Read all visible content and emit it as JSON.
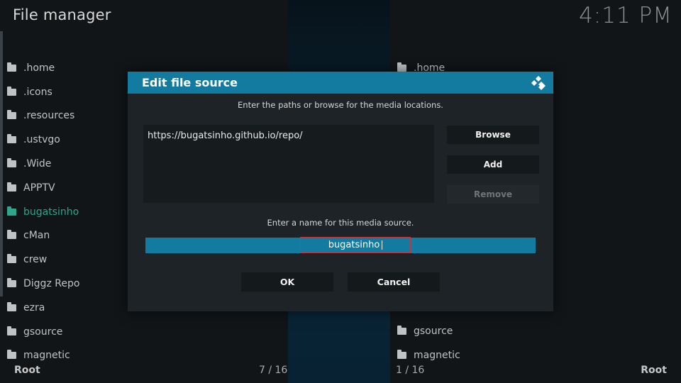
{
  "header": {
    "title": "File manager",
    "time": "4:11 PM"
  },
  "left_pane": {
    "items": [
      ".home",
      ".icons",
      ".resources",
      ".ustvgo",
      ".Wide",
      "APPTV",
      "bugatsinho",
      "cMan",
      "crew",
      "Diggz Repo",
      "ezra",
      "gsource",
      "magnetic"
    ],
    "footer_root": "Root",
    "footer_count": "7 / 16"
  },
  "right_pane": {
    "items_top": [
      ".home"
    ],
    "items_bottom": [
      "gsource",
      "magnetic"
    ],
    "footer_count": "1 / 16",
    "footer_root": "Root"
  },
  "dialog": {
    "title": "Edit file source",
    "instruction_paths": "Enter the paths or browse for the media locations.",
    "path": "https://bugatsinho.github.io/repo/",
    "browse_label": "Browse",
    "add_label": "Add",
    "remove_label": "Remove",
    "instruction_name": "Enter a name for this media source.",
    "name_value": "bugatsinho",
    "ok_label": "OK",
    "cancel_label": "Cancel"
  },
  "colors": {
    "accent": "#137aa0",
    "active_item": "#2fa58a",
    "focus_border": "#d1323a"
  }
}
